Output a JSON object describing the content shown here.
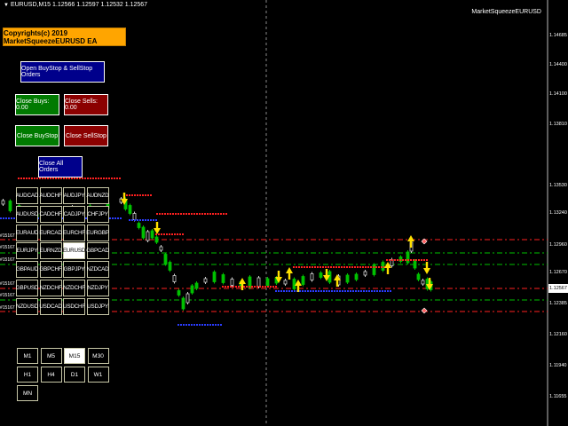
{
  "info_line": "EURUSD,M15  1.12566 1.12597 1.12532 1.12567",
  "ea_name": "MarketSqueezeEURUSD",
  "copyright": "Copyrights(c) 2019 MarketSqueezeEURUSD EA",
  "buttons": {
    "open_orders": "Open BuyStop & SellStop Orders",
    "close_buys": "Close Buys: 0.00",
    "close_sells": "Close Sells: 0.00",
    "close_buystop": "Close BuyStop",
    "close_sellstop": "Close SellStop",
    "close_all": "Close All Orders"
  },
  "pairs": [
    [
      "AUDCAD",
      "AUDCHF",
      "AUDJPY",
      "AUDNZD"
    ],
    [
      "AUDUSD",
      "CADCHF",
      "CADJPY",
      "CHFJPY"
    ],
    [
      "EURAUD",
      "EURCAD",
      "EURCHF",
      "EURGBP"
    ],
    [
      "EURJPY",
      "EURNZD",
      "EURUSD",
      "GBPCAD"
    ],
    [
      "GBPAUD",
      "GBPCHF",
      "GBPJPY",
      "NZDCAD"
    ],
    [
      "GBPUSD",
      "NZDCHF",
      "NZDCHF",
      "NZDJPY"
    ],
    [
      "NZDUSD",
      "USDCAD",
      "USDCHF",
      "USDJPY"
    ]
  ],
  "selected_pair": "EURUSD",
  "timeframes": [
    [
      "M1",
      "M5",
      "M15",
      "M30"
    ],
    [
      "H1",
      "H4",
      "D1",
      "W1"
    ],
    [
      "MN"
    ]
  ],
  "selected_timeframe": "M15",
  "price_axis": [
    "1.14685",
    "1.14400",
    "1.14100",
    "1.13810",
    "1.13530",
    "1.13240",
    "1.12960",
    "1.12670",
    "1.12385",
    "1.12160",
    "1.11940",
    "1.11655"
  ],
  "current_price": "1.12567",
  "ticket_labels": [
    "#15167",
    "#15167",
    "#15167",
    "#15167",
    "#15167",
    "#15167"
  ],
  "colors": {
    "buy_line": "#00c000",
    "sell_line": "#ff2020",
    "arrow": "#ffe000",
    "stop_blue": "#2a3cff"
  }
}
